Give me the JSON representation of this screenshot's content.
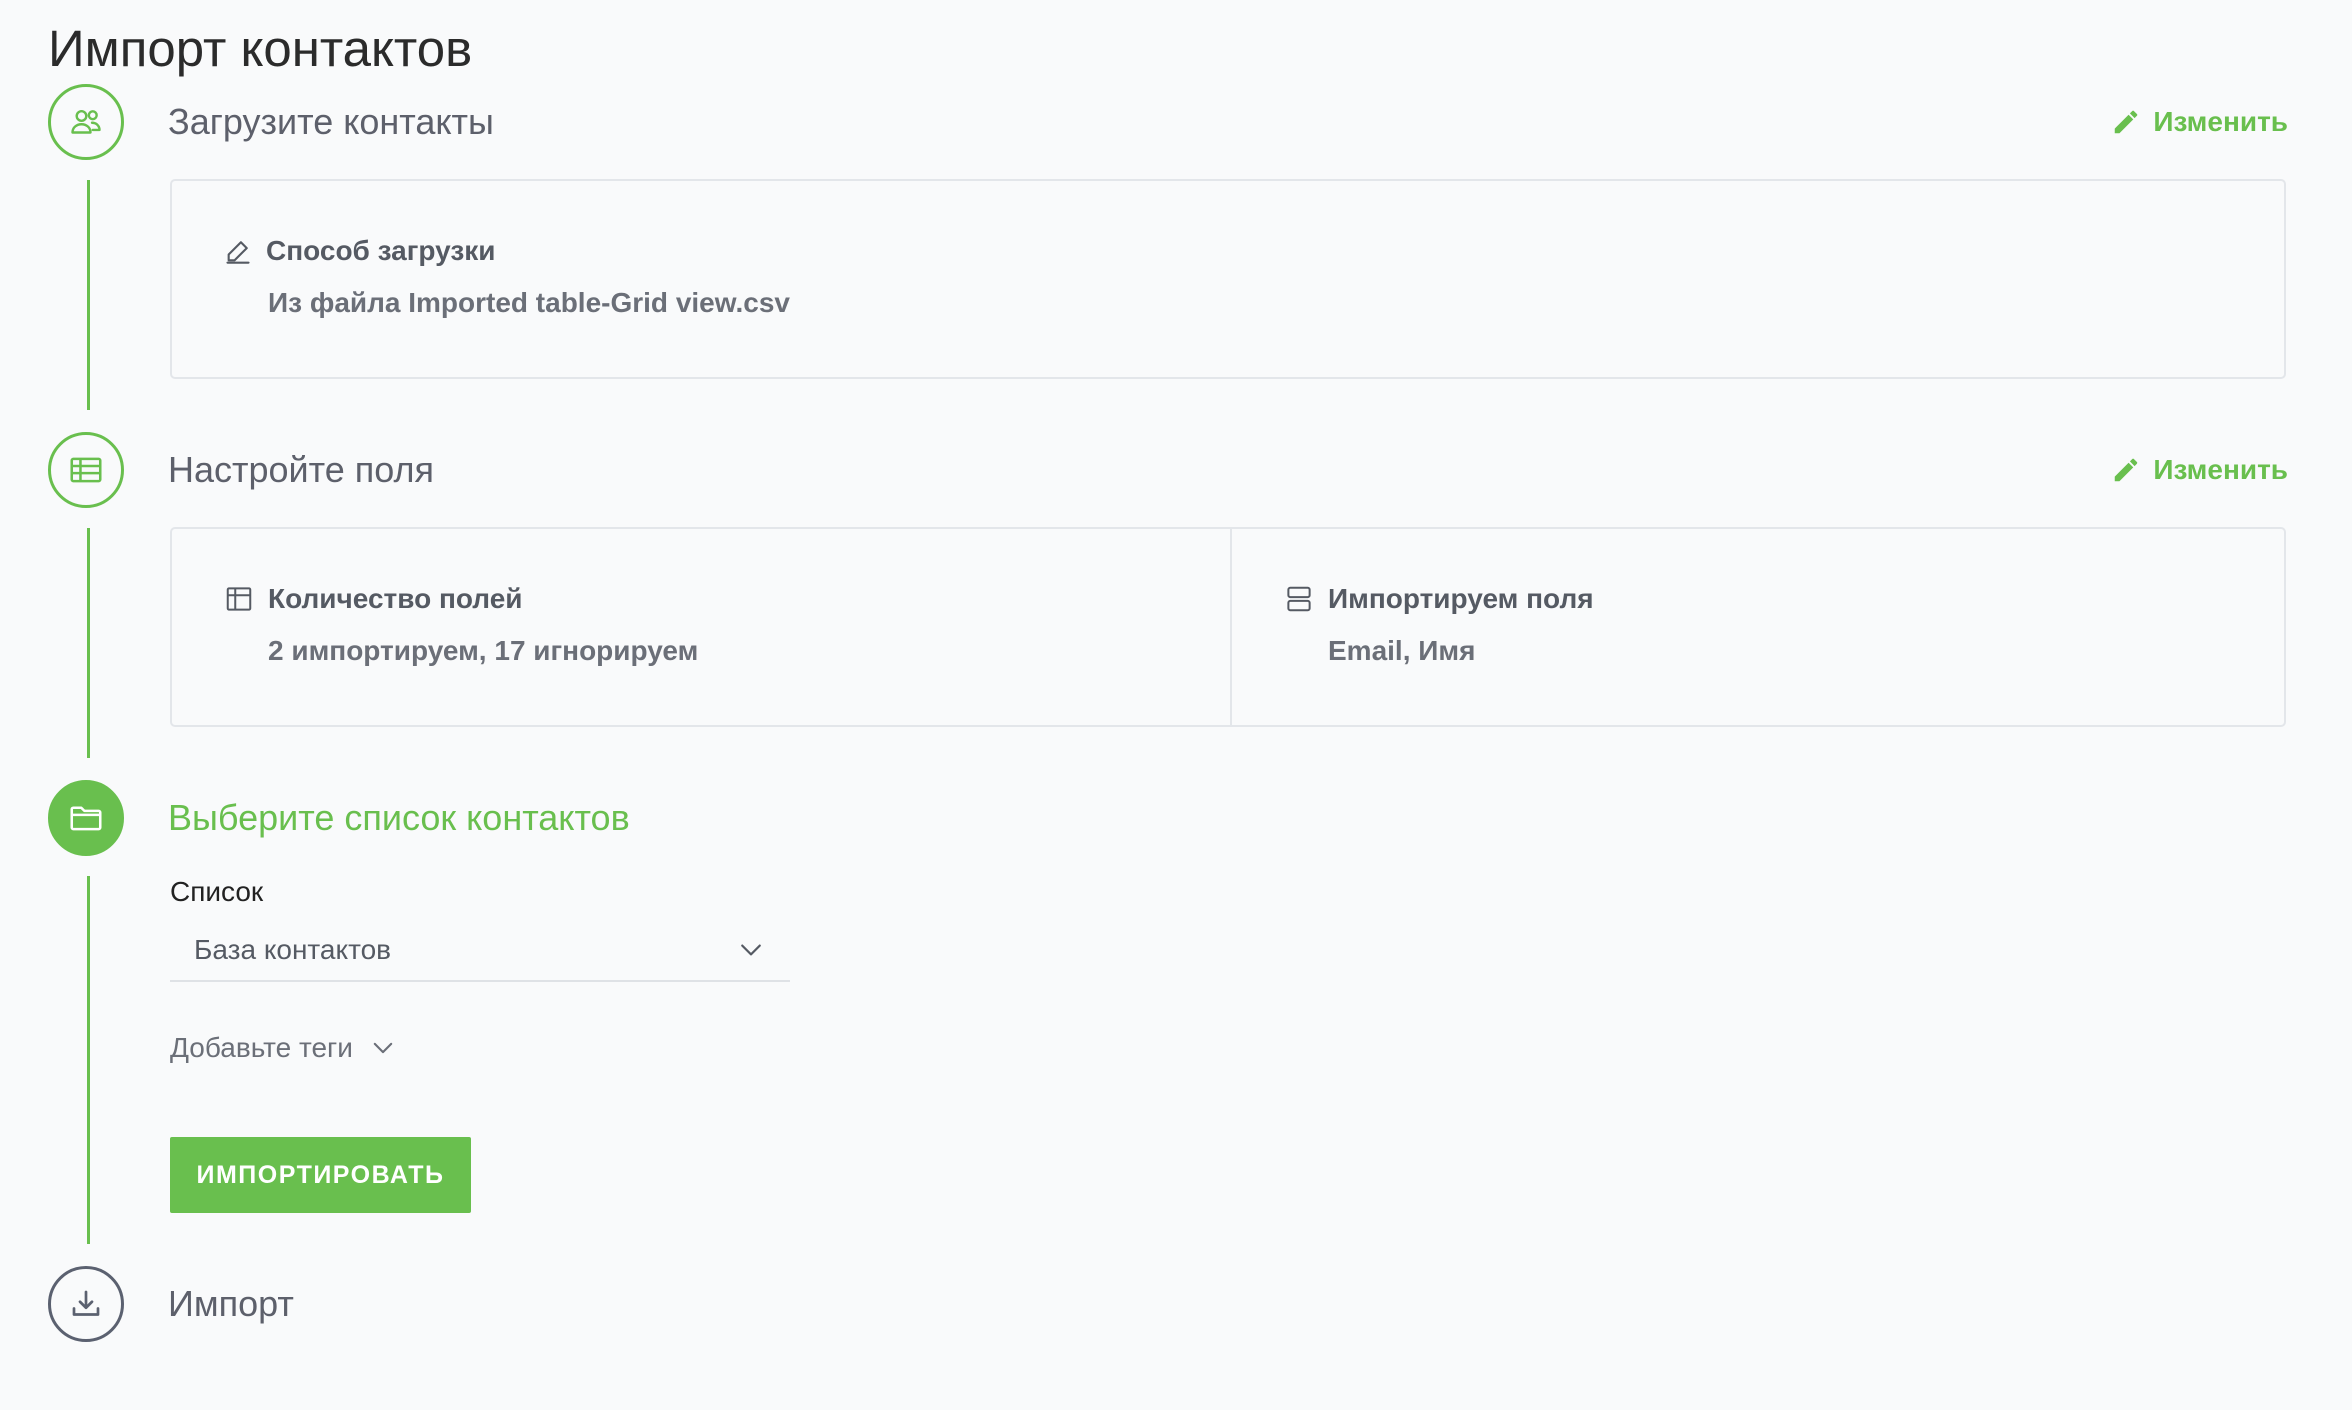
{
  "page": {
    "title": "Импорт контактов"
  },
  "steps": [
    {
      "title": "Загрузите контакты",
      "icon": "users-icon",
      "state": "completed",
      "edit_label": "Изменить",
      "summary": {
        "method_label": "Способ загрузки",
        "method_value": "Из файла Imported table-Grid view.csv"
      }
    },
    {
      "title": "Настройте поля",
      "icon": "table-icon",
      "state": "completed",
      "edit_label": "Изменить",
      "summary": {
        "count_label": "Количество полей",
        "count_value": "2 импортируем, 17 игнорируем",
        "fields_label": "Импортируем поля",
        "fields_value": "Email, Имя"
      }
    },
    {
      "title": "Выберите список контактов",
      "icon": "folder-icon",
      "state": "active",
      "form": {
        "list_label": "Список",
        "list_value": "База контактов",
        "tags_label": "Добавьте теги",
        "submit_label": "ИМПОРТИРОВАТЬ"
      }
    },
    {
      "title": "Импорт",
      "icon": "download-icon",
      "state": "pending"
    }
  ],
  "colors": {
    "accent": "#69bf4e",
    "background": "#f9fafb",
    "border": "#e3e6ea",
    "pending": "#5b6170"
  }
}
